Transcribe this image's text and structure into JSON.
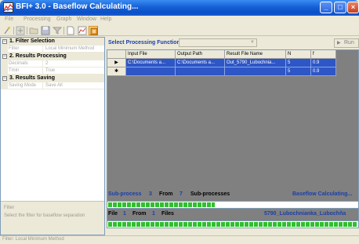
{
  "window": {
    "title": "BFI+ 3.0 - Baseflow Calculating..."
  },
  "menu": [
    "File",
    "Processing",
    "Graph",
    "Window",
    "Help"
  ],
  "toolbar": {
    "icons": [
      "wizard-icon",
      "add-icon",
      "open-folder-icon",
      "save-icon",
      "filter-icon",
      "new-doc-icon",
      "chart-icon",
      "process-icon"
    ]
  },
  "properties": {
    "categories": [
      {
        "label": "1. Filter Selection",
        "toggle": "−",
        "props": [
          {
            "name": "Filter",
            "value": "Local Minimum Method"
          }
        ]
      },
      {
        "label": "2. Results Processing",
        "toggle": "−",
        "props": [
          {
            "name": "Decimals",
            "value": "2"
          },
          {
            "name": "Tmin",
            "value": "True"
          }
        ]
      },
      {
        "label": "3. Results Saving",
        "toggle": "−",
        "props": [
          {
            "name": "Saving Mode",
            "value": "Save All"
          }
        ]
      }
    ],
    "help_title": "Filter",
    "help_desc": "Select the filter for baseflow separation"
  },
  "function_bar": {
    "label": "Select Processing Function",
    "selected": "",
    "run_label": "Run"
  },
  "grid": {
    "columns": [
      "Input File",
      "Output Path",
      "Result File Name",
      "N",
      "f"
    ],
    "rows": [
      {
        "marker": "▶",
        "cells": [
          "C:\\Documents a...",
          "C:\\Documents a...",
          "Out_5790_Lubochnia...",
          "5",
          "0.9"
        ]
      },
      {
        "marker": "✱",
        "cells": [
          "",
          "",
          "",
          "5",
          "0.9"
        ]
      }
    ]
  },
  "status": {
    "subprocess_label": "Sub-process",
    "subprocess_current": "3",
    "from_label": "From",
    "subprocess_total": "7",
    "subprocesses_label": "Sub-processes",
    "state_label": "Baseflow Calculating...",
    "subprocess_progress": 0.43,
    "file_label": "File",
    "file_current": "1",
    "file_from_label": "From",
    "file_total": "1",
    "files_label": "Files",
    "file_name": "5790_Lubochnianka_Lubochňa",
    "file_progress": 1.0
  },
  "statusbar": {
    "text": "Filter: Local Minimum Method"
  },
  "colors": {
    "accent": "#1a3fa8",
    "selection": "#2d56c6",
    "progress": "#2fbf2f"
  }
}
